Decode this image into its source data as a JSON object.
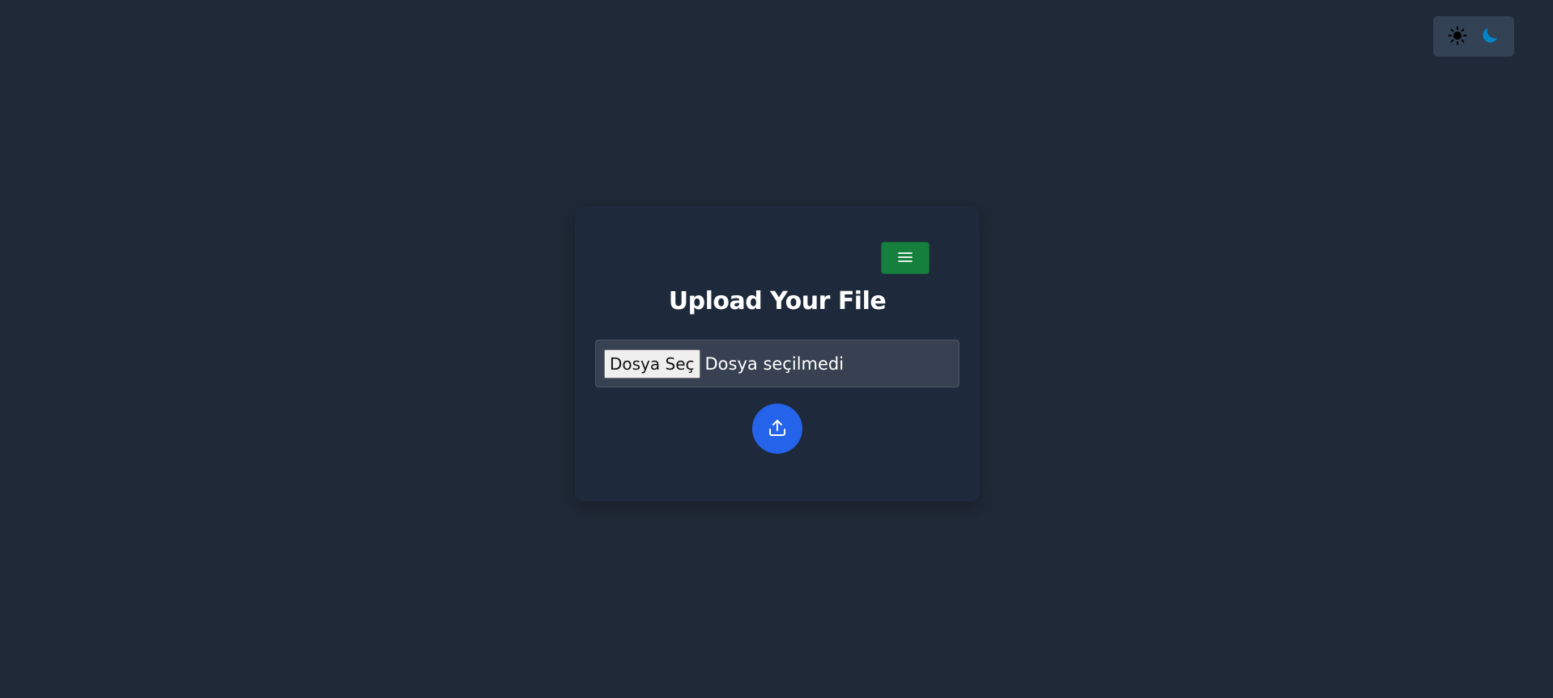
{
  "theme": {
    "light_icon": "sun-icon",
    "dark_icon": "moon-icon",
    "dark_icon_color": "#0284c7"
  },
  "card": {
    "menu_icon": "hamburger-menu-icon",
    "menu_button_color": "#15803d",
    "title": "Upload Your File",
    "file_input": {
      "button_label": "Dosya Seç",
      "status_text": "Dosya seçilmedi"
    },
    "upload_icon": "upload-icon",
    "upload_button_color": "#2563eb"
  }
}
